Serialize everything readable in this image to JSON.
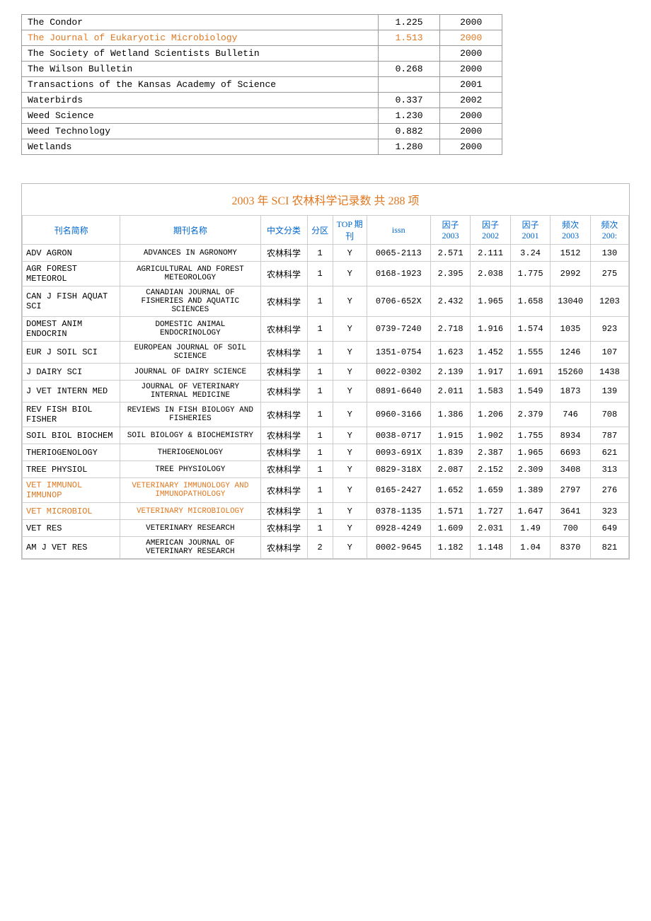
{
  "topTable": {
    "rows": [
      {
        "name": "The Condor",
        "impact": "1.225",
        "year": "2000",
        "highlight": false
      },
      {
        "name": "The Journal of Eukaryotic Microbiology",
        "impact": "1.513",
        "year": "2000",
        "highlight": true
      },
      {
        "name": "The Society of Wetland Scientists Bulletin",
        "impact": "",
        "year": "2000",
        "highlight": false
      },
      {
        "name": "The Wilson Bulletin",
        "impact": "0.268",
        "year": "2000",
        "highlight": false
      },
      {
        "name": "Transactions of the Kansas Academy of Science",
        "impact": "",
        "year": "2001",
        "highlight": false
      },
      {
        "name": "Waterbirds",
        "impact": "0.337",
        "year": "2002",
        "highlight": false
      },
      {
        "name": "Weed Science",
        "impact": "1.230",
        "year": "2000",
        "highlight": false
      },
      {
        "name": "Weed Technology",
        "impact": "0.882",
        "year": "2000",
        "highlight": false
      },
      {
        "name": "Wetlands",
        "impact": "1.280",
        "year": "2000",
        "highlight": false
      }
    ]
  },
  "bottomSection": {
    "title": "2003 年 SCI 农林科学记录数  共 288 项",
    "headers": {
      "abbr": "刊名简称",
      "full": "期刊名称",
      "cnClass": "中文分类",
      "zone": "分区",
      "top": "TOP 期刊",
      "issn": "issn",
      "f2003": "因子\n2003",
      "f2002": "因子\n2002",
      "f2001": "因子\n2001",
      "freq2003": "频次\n2003",
      "freq2002": "频次\n200:"
    },
    "rows": [
      {
        "abbr": "ADV AGRON",
        "full": "ADVANCES IN AGRONOMY",
        "cn": "农林科学",
        "zone": "1",
        "top": "Y",
        "issn": "0065-2113",
        "f03": "2.571",
        "f02": "2.111",
        "f01": "3.24",
        "freq03": "1512",
        "freq02": "130",
        "highlight": false
      },
      {
        "abbr": "AGR FOREST METEOROL",
        "full": "AGRICULTURAL AND FOREST METEOROLOGY",
        "cn": "农林科学",
        "zone": "1",
        "top": "Y",
        "issn": "0168-1923",
        "f03": "2.395",
        "f02": "2.038",
        "f01": "1.775",
        "freq03": "2992",
        "freq02": "275",
        "highlight": false
      },
      {
        "abbr": "CAN J FISH AQUAT SCI",
        "full": "CANADIAN JOURNAL OF FISHERIES AND AQUATIC SCIENCES",
        "cn": "农林科学",
        "zone": "1",
        "top": "Y",
        "issn": "0706-652X",
        "f03": "2.432",
        "f02": "1.965",
        "f01": "1.658",
        "freq03": "13040",
        "freq02": "1203",
        "highlight": false
      },
      {
        "abbr": "DOMEST ANIM ENDOCRIN",
        "full": "DOMESTIC ANIMAL ENDOCRINOLOGY",
        "cn": "农林科学",
        "zone": "1",
        "top": "Y",
        "issn": "0739-7240",
        "f03": "2.718",
        "f02": "1.916",
        "f01": "1.574",
        "freq03": "1035",
        "freq02": "923",
        "highlight": false
      },
      {
        "abbr": "EUR J SOIL SCI",
        "full": "EUROPEAN JOURNAL OF SOIL SCIENCE",
        "cn": "农林科学",
        "zone": "1",
        "top": "Y",
        "issn": "1351-0754",
        "f03": "1.623",
        "f02": "1.452",
        "f01": "1.555",
        "freq03": "1246",
        "freq02": "107",
        "highlight": false
      },
      {
        "abbr": "J DAIRY SCI",
        "full": "JOURNAL OF DAIRY SCIENCE",
        "cn": "农林科学",
        "zone": "1",
        "top": "Y",
        "issn": "0022-0302",
        "f03": "2.139",
        "f02": "1.917",
        "f01": "1.691",
        "freq03": "15260",
        "freq02": "1438",
        "highlight": false
      },
      {
        "abbr": "J VET INTERN MED",
        "full": "JOURNAL OF VETERINARY INTERNAL MEDICINE",
        "cn": "农林科学",
        "zone": "1",
        "top": "Y",
        "issn": "0891-6640",
        "f03": "2.011",
        "f02": "1.583",
        "f01": "1.549",
        "freq03": "1873",
        "freq02": "139",
        "highlight": false
      },
      {
        "abbr": "REV FISH BIOL FISHER",
        "full": "REVIEWS IN FISH BIOLOGY AND FISHERIES",
        "cn": "农林科学",
        "zone": "1",
        "top": "Y",
        "issn": "0960-3166",
        "f03": "1.386",
        "f02": "1.206",
        "f01": "2.379",
        "freq03": "746",
        "freq02": "708",
        "highlight": false
      },
      {
        "abbr": "SOIL BIOL BIOCHEM",
        "full": "SOIL BIOLOGY & BIOCHEMISTRY",
        "cn": "农林科学",
        "zone": "1",
        "top": "Y",
        "issn": "0038-0717",
        "f03": "1.915",
        "f02": "1.902",
        "f01": "1.755",
        "freq03": "8934",
        "freq02": "787",
        "highlight": false
      },
      {
        "abbr": "THERIOGENOLOGY",
        "full": "THERIOGENOLOGY",
        "cn": "农林科学",
        "zone": "1",
        "top": "Y",
        "issn": "0093-691X",
        "f03": "1.839",
        "f02": "2.387",
        "f01": "1.965",
        "freq03": "6693",
        "freq02": "621",
        "highlight": false
      },
      {
        "abbr": "TREE PHYSIOL",
        "full": "TREE PHYSIOLOGY",
        "cn": "农林科学",
        "zone": "1",
        "top": "Y",
        "issn": "0829-318X",
        "f03": "2.087",
        "f02": "2.152",
        "f01": "2.309",
        "freq03": "3408",
        "freq02": "313",
        "highlight": false
      },
      {
        "abbr": "VET IMMUNOL IMMUNOP",
        "full": "VETERINARY IMMUNOLOGY AND IMMUNOPATHOLOGY",
        "cn": "农林科学",
        "zone": "1",
        "top": "Y",
        "issn": "0165-2427",
        "f03": "1.652",
        "f02": "1.659",
        "f01": "1.389",
        "freq03": "2797",
        "freq02": "276",
        "highlight": true
      },
      {
        "abbr": "VET MICROBIOL",
        "full": "VETERINARY MICROBIOLOGY",
        "cn": "农林科学",
        "zone": "1",
        "top": "Y",
        "issn": "0378-1135",
        "f03": "1.571",
        "f02": "1.727",
        "f01": "1.647",
        "freq03": "3641",
        "freq02": "323",
        "highlight": true
      },
      {
        "abbr": "VET RES",
        "full": "VETERINARY RESEARCH",
        "cn": "农林科学",
        "zone": "1",
        "top": "Y",
        "issn": "0928-4249",
        "f03": "1.609",
        "f02": "2.031",
        "f01": "1.49",
        "freq03": "700",
        "freq02": "649",
        "highlight": false
      },
      {
        "abbr": "AM J VET RES",
        "full": "AMERICAN JOURNAL OF VETERINARY RESEARCH",
        "cn": "农林科学",
        "zone": "2",
        "top": "Y",
        "issn": "0002-9645",
        "f03": "1.182",
        "f02": "1.148",
        "f01": "1.04",
        "freq03": "8370",
        "freq02": "821",
        "highlight": false
      }
    ]
  }
}
